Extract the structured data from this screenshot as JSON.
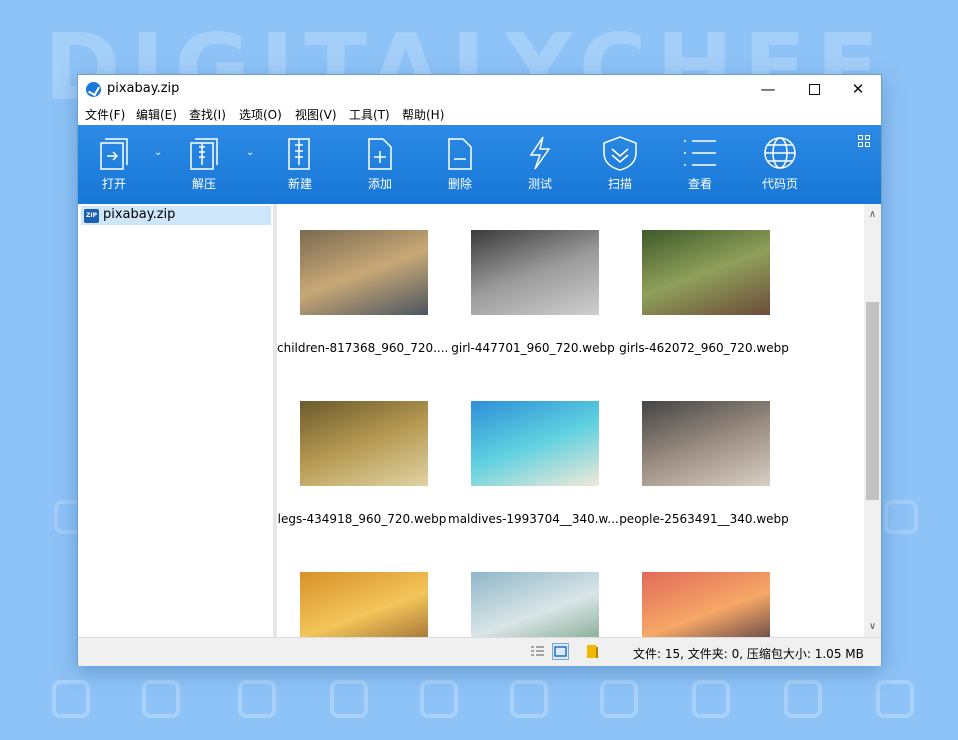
{
  "window": {
    "title": "pixabay.zip"
  },
  "menu": [
    "文件(F)",
    "编辑(E)",
    "查找(I)",
    "选项(O)",
    "视图(V)",
    "工具(T)",
    "帮助(H)"
  ],
  "toolbar": {
    "open": "打开",
    "extract": "解压",
    "new": "新建",
    "add": "添加",
    "delete": "删除",
    "test": "测试",
    "scan": "扫描",
    "view": "查看",
    "codepage": "代码页"
  },
  "tree": {
    "item": "pixabay.zip"
  },
  "files": [
    {
      "name": "children-817368_960_720....",
      "colors": [
        "#7a6a52",
        "#c9a876",
        "#4b5560"
      ]
    },
    {
      "name": "girl-447701_960_720.webp",
      "colors": [
        "#3a3a3a",
        "#9a9a9a",
        "#cfcfcf"
      ]
    },
    {
      "name": "girls-462072_960_720.webp",
      "colors": [
        "#3e5a2a",
        "#8fa05a",
        "#6c4b3a"
      ]
    },
    {
      "name": "legs-434918_960_720.webp",
      "colors": [
        "#6b5a2c",
        "#b79a52",
        "#e0d3a4"
      ]
    },
    {
      "name": "maldives-1993704__340.w...",
      "colors": [
        "#2d8fd8",
        "#5fd1e0",
        "#f1e9d8"
      ]
    },
    {
      "name": "people-2563491__340.webp",
      "colors": [
        "#444444",
        "#9a8c80",
        "#d9cfc4"
      ]
    },
    {
      "name": "",
      "colors": [
        "#d9902a",
        "#f3c55a",
        "#8a5a2a"
      ]
    },
    {
      "name": "",
      "colors": [
        "#8fb7c9",
        "#d9e5e8",
        "#6e9a7a"
      ]
    },
    {
      "name": "",
      "colors": [
        "#e26a5a",
        "#f6a866",
        "#3a2a40"
      ]
    }
  ],
  "status": {
    "text": "文件: 15, 文件夹: 0, 压缩包大小: 1.05 MB"
  },
  "background": {
    "watermark": "DIGITALYCHEF"
  }
}
